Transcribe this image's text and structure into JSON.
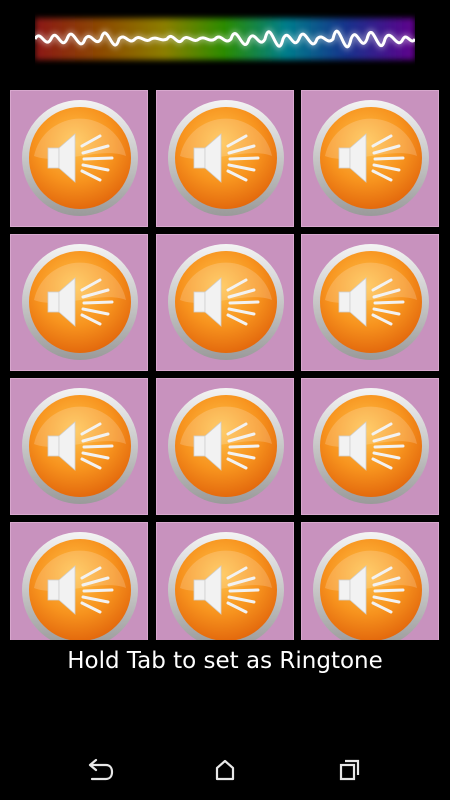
{
  "banner": {
    "icon": "sound-wave-banner",
    "colors": [
      "#ff2a2a",
      "#ff8a00",
      "#ffe600",
      "#4cff00",
      "#00e5ff",
      "#2a5cff",
      "#b000ff"
    ]
  },
  "grid": {
    "columns": 3,
    "tile_color": "#c892be",
    "button_color": "#f7931e",
    "tiles": [
      {
        "icon": "speaker-icon"
      },
      {
        "icon": "speaker-icon"
      },
      {
        "icon": "speaker-icon"
      },
      {
        "icon": "speaker-icon"
      },
      {
        "icon": "speaker-icon"
      },
      {
        "icon": "speaker-icon"
      },
      {
        "icon": "speaker-icon"
      },
      {
        "icon": "speaker-icon"
      },
      {
        "icon": "speaker-icon"
      },
      {
        "icon": "speaker-icon"
      },
      {
        "icon": "speaker-icon"
      },
      {
        "icon": "speaker-icon"
      }
    ]
  },
  "footer": {
    "hint": "Hold Tab to set as Ringtone"
  },
  "navbar": {
    "buttons": [
      {
        "name": "back",
        "icon": "back-icon"
      },
      {
        "name": "home",
        "icon": "home-icon"
      },
      {
        "name": "recents",
        "icon": "recents-icon"
      }
    ]
  }
}
